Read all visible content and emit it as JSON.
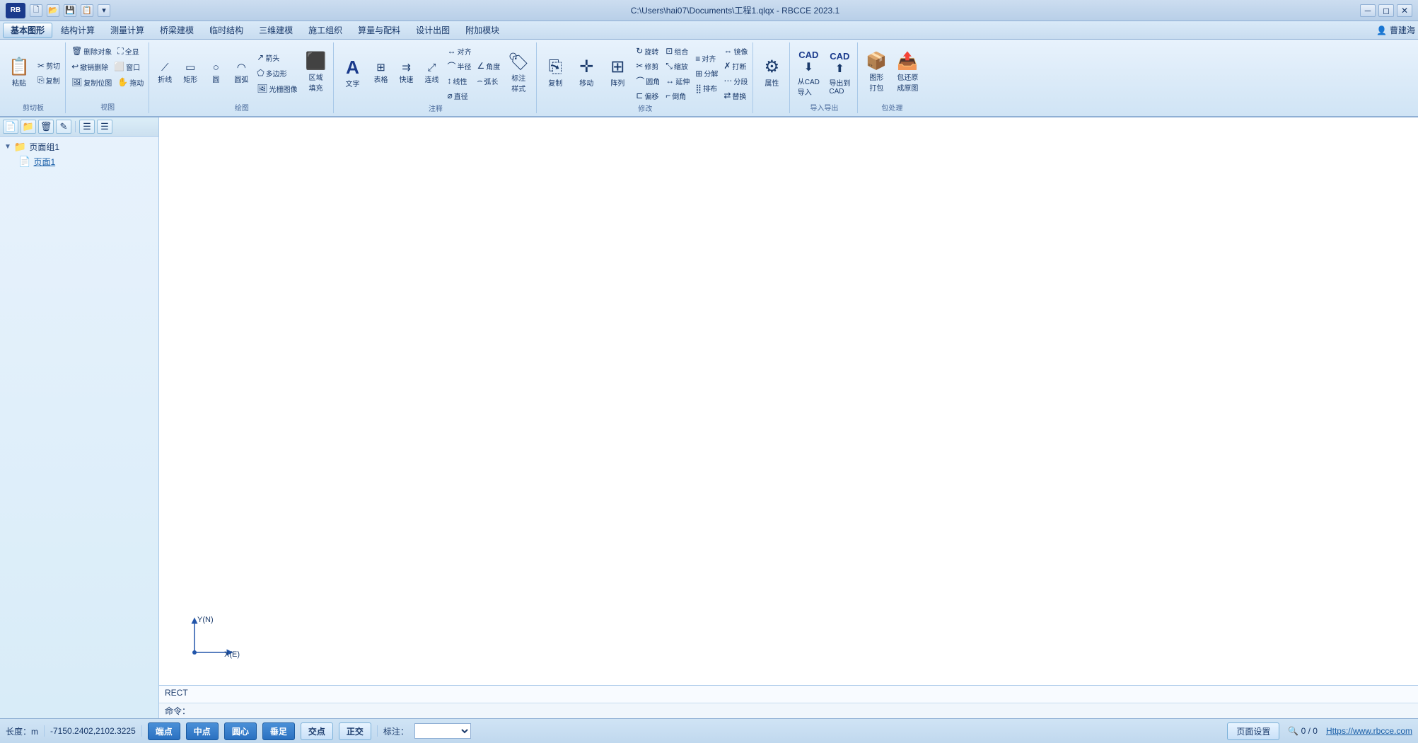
{
  "titlebar": {
    "title": "C:\\Users\\hai07\\Documents\\工程1.qlqx - RBCCE 2023.1",
    "logo": "RB",
    "buttons": {
      "new": "🗋",
      "open": "📂",
      "save": "💾",
      "saveas": "📋",
      "more": "▾",
      "minimize": "─",
      "restore": "◻",
      "close": "✕"
    }
  },
  "menubar": {
    "items": [
      "基本图形",
      "结构计算",
      "测量计算",
      "桥梁建模",
      "临时结构",
      "三维建模",
      "施工组织",
      "算量与配料",
      "设计出图",
      "附加模块"
    ],
    "active": "基本图形",
    "user": "曹建海"
  },
  "toolbar": {
    "groups": {
      "clipboard": {
        "label": "剪切板",
        "paste": "粘贴",
        "cut": "剪切",
        "copy": "复制"
      },
      "view": {
        "label": "视图",
        "delete": "删除对象",
        "undo": "撤销删除",
        "copy_pic": "复制位图",
        "fullscreen": "全显",
        "window": "窗口",
        "drag": "拖动"
      },
      "draw": {
        "label": "绘图",
        "polyline": "折线",
        "rect": "矩形",
        "circle": "圆",
        "arc": "圆弧",
        "arrow": "箭头",
        "polygon": "多边形",
        "hatch": "光栅图像",
        "fill": "区域填充"
      },
      "annotate": {
        "label": "注释",
        "text": "文字",
        "table": "表格",
        "quick": "快速",
        "connect": "连线",
        "align": "对齐",
        "half_radius": "半径",
        "linear": "线性",
        "diameter": "直径",
        "angle": "角度",
        "arc_len": "弧长",
        "marker": "标注样式"
      },
      "modify": {
        "label": "修改",
        "copy2": "复制",
        "move": "移动",
        "array": "阵列",
        "rotate": "旋转",
        "trim": "修剪",
        "round": "圆角",
        "offset": "偏移",
        "merge": "组合",
        "scale": "缩放",
        "extend": "延伸",
        "chamfer": "倒角",
        "align2": "对齐",
        "explode": "分解",
        "arrange": "排布",
        "mirror": "镜像",
        "cut2": "打断",
        "divide": "分段",
        "replace": "替换"
      },
      "property": {
        "label": "",
        "properties": "属性"
      },
      "import_export": {
        "label": "导入导出",
        "from_cad": "从CAD\n导入",
        "to_cad": "导出到\nCAD"
      },
      "package": {
        "label": "包处理",
        "shape": "图形\n打包",
        "restore": "包还原\n成原图"
      }
    }
  },
  "left_panel": {
    "buttons": {
      "new": "📄",
      "folder": "📁",
      "delete": "🗑",
      "rename": "✎",
      "align_left": "⬅",
      "align_right": "➡"
    },
    "tree": {
      "group1": "页面组1",
      "page1": "页面1"
    }
  },
  "canvas": {
    "axis_y": "Y(N)",
    "axis_x": "X(E)",
    "command_text": "RECT",
    "command_prompt": "命令："
  },
  "statusbar": {
    "length_label": "长度：m",
    "coordinates": "-7150.2402,2102.3225",
    "snap_buttons": [
      "端点",
      "中点",
      "圆心",
      "垂足",
      "交点",
      "正交"
    ],
    "active_snaps": [
      "端点",
      "中点",
      "圆心",
      "垂足"
    ],
    "markup_label": "标注：",
    "markup_placeholder": "",
    "page_settings": "页面设置",
    "coordinate_display": "🔍 0 / 0",
    "website": "Https://www.rbcce.com"
  }
}
